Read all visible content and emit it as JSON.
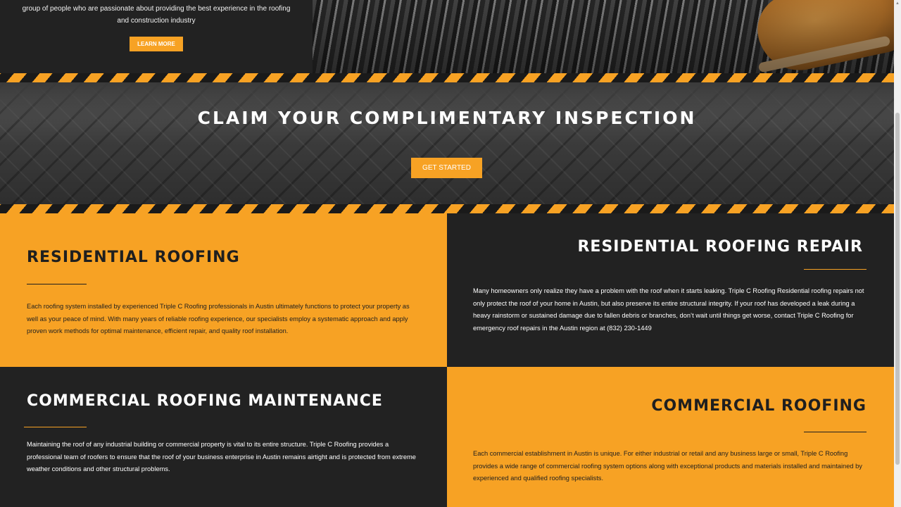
{
  "top": {
    "text_line1": "group of people who are passionate about providing the best experience in the roofing",
    "text_line2": "and construction industry",
    "learn_more": "LEARN MORE"
  },
  "banner": {
    "title": "CLAIM YOUR COMPLIMENTARY INSPECTION",
    "cta": "GET STARTED"
  },
  "sections": [
    {
      "title": "RESIDENTIAL ROOFING",
      "body": "Each roofing system installed by experienced Triple C Roofing professionals in Austin ultimately functions to protect your property as well as your peace of mind. With many years of reliable roofing experience, our specialists employ a systematic approach and apply proven work methods for optimal maintenance, efficient repair, and quality roof installation."
    },
    {
      "title": "RESIDENTIAL ROOFING REPAIR",
      "body": "Many homeowners only realize they have a problem with the roof when it starts leaking. Triple C Roofing Residential roofing repairs not only protect the roof of your home in Austin, but also preserve its entire structural integrity. If your roof has developed a leak during a heavy rainstorm or sustained damage due to fallen debris or branches, don’t wait until things get worse, contact Triple C Roofing for emergency roof repairs in the Austin region at (832) 230-1449"
    },
    {
      "title": "COMMERCIAL ROOFING MAINTENANCE",
      "body": "Maintaining the roof of any industrial building or commercial property is vital to its entire structure. Triple C Roofing provides a professional team of roofers to ensure that the roof of your business enterprise in Austin remains airtight and is protected from extreme weather conditions and other structural problems."
    },
    {
      "title": "COMMERCIAL ROOFING",
      "body": "Each commercial establishment in Austin is unique. For either industrial or retail and any business large or small, Triple C Roofing provides a wide range of commercial roofing system options along with exceptional products and materials installed and maintained by experienced and qualified roofing specialists."
    }
  ],
  "colors": {
    "accent": "#f7a224",
    "dark": "#222222"
  },
  "icons": {
    "scroll_up": "chevron-up-icon"
  }
}
